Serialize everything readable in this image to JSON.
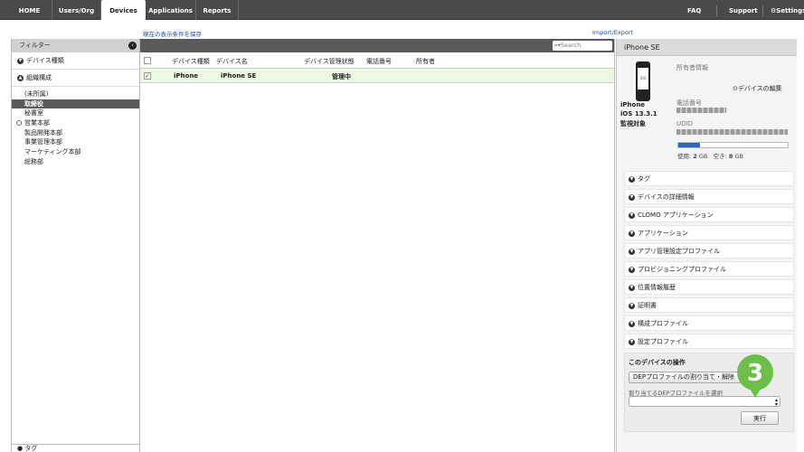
{
  "nav": {
    "tabs": [
      "HOME",
      "Users/Org",
      "Devices",
      "Applications",
      "Reports"
    ],
    "active_tab": "Devices",
    "right": [
      "FAQ",
      "Support",
      "Settings"
    ]
  },
  "links": {
    "save_view": "現在の表示条件を保存",
    "import_export": "Import/Export"
  },
  "sidebar": {
    "title": "フィルター",
    "sections": [
      "デバイス種類",
      "組織構成"
    ],
    "org_items": [
      "(未所属)",
      "取締役",
      "秘書室",
      "営業本部",
      "製品開発本部",
      "事業管理本部",
      "マーケティング本部",
      "総務部"
    ],
    "selected_item": "取締役",
    "bottom_label": "タグ"
  },
  "search": {
    "placeholder": "Search"
  },
  "table": {
    "columns": [
      "デバイス種類",
      "デバイス名",
      "デバイス管理状態",
      "電話番号",
      "所有者"
    ],
    "rows": [
      {
        "type": "iPhone",
        "name": "iPhone SE",
        "status": "管理中",
        "phone": "",
        "owner": "",
        "checked": true
      }
    ]
  },
  "device_panel": {
    "title": "iPhone SE",
    "owner_label": "所有者情報",
    "edit_link": "デバイスの編集",
    "phone_screen_label": "iOS",
    "model": "iPhone",
    "os": "iOS 13.3.1",
    "supervised": "監視対象",
    "phone_label": "電話番号",
    "udid_label": "UDID",
    "usage": {
      "used_label": "使用:",
      "used_value": "2",
      "free_label": "空き:",
      "free_value": "8",
      "unit": "GB",
      "used_fraction": 0.2
    },
    "sections": [
      "タグ",
      "デバイスの詳細情報",
      "CLOMO アプリケーション",
      "アプリケーション",
      "アプリ管理設定プロファイル",
      "プロビジョニングプロファイル",
      "位置情報履歴",
      "証明書",
      "構成プロファイル",
      "設定プロファイル"
    ],
    "ops": {
      "title": "このデバイスの操作",
      "action_select": "DEPプロファイルの割り当て・解除",
      "select_label": "割り当てるDEPプロファイルを選択",
      "execute_button": "実行"
    }
  },
  "step_badge": "3",
  "colors": {
    "accent_blue": "#2b68c5",
    "badge_green": "#6cc04a",
    "nav_bg": "#4a4a4a"
  }
}
